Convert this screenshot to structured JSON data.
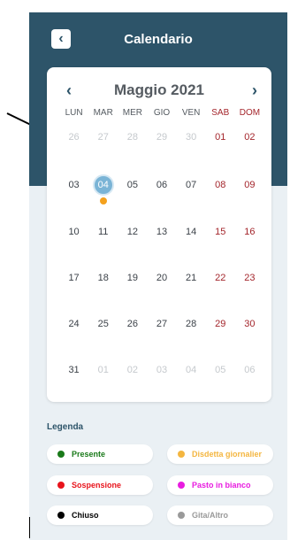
{
  "header": {
    "back_icon": "chevron-left-icon",
    "title": "Calendario"
  },
  "calendar": {
    "month_label": "Maggio 2021",
    "prev_icon": "chevron-left-icon",
    "next_icon": "chevron-right-icon",
    "weekdays": [
      "LUN",
      "MAR",
      "MER",
      "GIO",
      "VEN",
      "SAB",
      "DOM"
    ],
    "weeks": [
      [
        "26",
        "27",
        "28",
        "29",
        "30",
        "01",
        "02"
      ],
      [
        "03",
        "04",
        "05",
        "06",
        "07",
        "08",
        "09"
      ],
      [
        "10",
        "11",
        "12",
        "13",
        "14",
        "15",
        "16"
      ],
      [
        "17",
        "18",
        "19",
        "20",
        "21",
        "22",
        "23"
      ],
      [
        "24",
        "25",
        "26",
        "27",
        "28",
        "29",
        "30"
      ],
      [
        "31",
        "01",
        "02",
        "03",
        "04",
        "05",
        "06"
      ]
    ],
    "selected_day": "04"
  },
  "legend": {
    "title": "Legenda",
    "items": [
      {
        "label": "Presente",
        "color": "#1a7a1a"
      },
      {
        "label": "Disdetta giornalier",
        "color": "#f4b640"
      },
      {
        "label": "Sospensione",
        "color": "#e8141c"
      },
      {
        "label": "Pasto in bianco",
        "color": "#e81ce0"
      },
      {
        "label": "Chiuso",
        "color": "#000000"
      },
      {
        "label": "Gita/Altro",
        "color": "#9a9a9a"
      }
    ]
  },
  "colors": {
    "header_bg": "#2d5469",
    "today_circle": "#7ab4d6",
    "weekend": "#a4262c",
    "marker_dot": "#f4a11d"
  }
}
